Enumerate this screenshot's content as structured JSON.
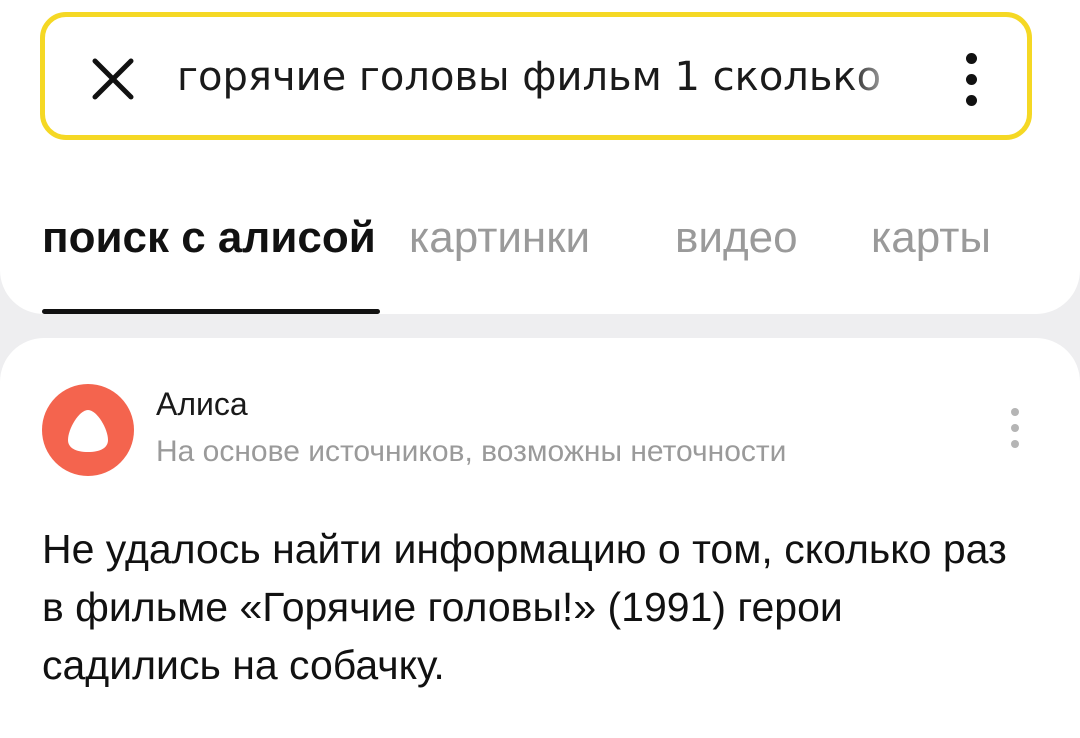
{
  "search": {
    "query": "горячие головы фильм 1 сколько",
    "clear_icon": "close-icon",
    "menu_icon": "kebab-menu-icon",
    "accent_color": "#f5d824"
  },
  "tabs": [
    {
      "label": "поиск с алисой",
      "active": true
    },
    {
      "label": "картинки",
      "active": false
    },
    {
      "label": "видео",
      "active": false
    },
    {
      "label": "карты",
      "active": false
    },
    {
      "label": "",
      "active": false
    }
  ],
  "answer": {
    "avatar_icon": "alice-logo-icon",
    "avatar_color": "#f4644e",
    "source_name": "Алиса",
    "source_note": "На основе источников, возможны неточности",
    "menu_icon": "more-vertical-icon",
    "text": "Не удалось найти информацию о том, сколько раз в фильме «Горячие головы!» (1991) герои садились на собачку."
  }
}
